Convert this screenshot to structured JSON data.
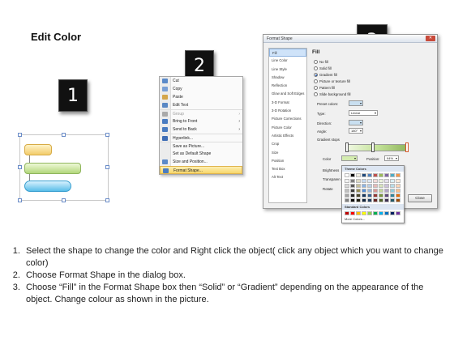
{
  "title": "Edit Color",
  "steps": [
    "1",
    "2",
    "3"
  ],
  "context_menu": {
    "items": [
      {
        "label": "Cut",
        "underline": "t",
        "icon": "scissors-icon",
        "color": "#5b8ac9"
      },
      {
        "label": "Copy",
        "icon": "copy-icon",
        "color": "#7aa0d6"
      },
      {
        "label": "Paste",
        "icon": "paste-icon",
        "color": "#d4a64b"
      },
      {
        "label": "Edit Text",
        "icon": "edit-text-icon",
        "color": "#5a88c4"
      },
      {
        "label": "Group",
        "icon": "group-icon",
        "color": "#aaaaaa",
        "disabled": true,
        "submenu": true
      },
      {
        "label": "Bring to Front",
        "icon": "bring-front-icon",
        "color": "#4a7cc1",
        "submenu": true
      },
      {
        "label": "Send to Back",
        "icon": "send-back-icon",
        "color": "#4a7cc1",
        "submenu": true
      },
      {
        "label": "Hyperlink...",
        "icon": "hyperlink-icon",
        "color": "#3e6db5"
      },
      {
        "label": "Save as Picture...",
        "icon": "",
        "color": ""
      },
      {
        "label": "Set as Default Shape",
        "icon": "",
        "color": ""
      },
      {
        "label": "Size and Position...",
        "icon": "size-icon",
        "color": "#5b8ac9"
      },
      {
        "label": "Format Shape...",
        "icon": "format-shape-icon",
        "color": "#4a7cc1",
        "highlighted": true
      }
    ]
  },
  "dialog": {
    "title": "Format Shape",
    "categories": [
      "Fill",
      "Line Color",
      "Line Style",
      "Shadow",
      "Reflection",
      "Glow and Soft Edges",
      "3-D Format",
      "3-D Rotation",
      "Picture Corrections",
      "Picture Color",
      "Artistic Effects",
      "Crop",
      "Size",
      "Position",
      "Text Box",
      "Alt Text"
    ],
    "selected_category": "Fill",
    "pane_heading": "Fill",
    "fill_options": [
      "No fill",
      "Solid fill",
      "Gradient fill",
      "Picture or texture fill",
      "Pattern fill",
      "Slide background fill"
    ],
    "selected_fill": "Gradient fill",
    "preset_colors_label": "Preset colors:",
    "type_label": "Type:",
    "type_value": "Linear",
    "direction_label": "Direction:",
    "angle_label": "Angle:",
    "angle_value": "180°",
    "gradient_stops_label": "Gradient stops",
    "color_label": "Color",
    "position_label": "Position:",
    "position_value": "94%",
    "brightness_label": "Brightness",
    "transparency_label": "Transparen",
    "rotate_label": "Rotate",
    "close_label": "Close",
    "palette": {
      "theme_header": "Theme Colors",
      "standard_header": "Standard Colors",
      "more_colors": "More Colors...",
      "theme_top": [
        "#ffffff",
        "#000000",
        "#eeece1",
        "#1f497d",
        "#4f81bd",
        "#c0504d",
        "#9bbb59",
        "#8064a2",
        "#4bacc6",
        "#f79646"
      ],
      "theme_shades": [
        [
          "#f2f2f2",
          "#7f7f7f",
          "#ddd9c3",
          "#c6d9f0",
          "#dbe5f1",
          "#f2dcdb",
          "#ebf1dd",
          "#e5e0ec",
          "#dbeef3",
          "#fdeada"
        ],
        [
          "#d8d8d8",
          "#595959",
          "#c4bd97",
          "#8db3e2",
          "#b8cce4",
          "#e5b9b7",
          "#d7e3bc",
          "#ccc1d9",
          "#b7dde8",
          "#fbd5b5"
        ],
        [
          "#bfbfbf",
          "#3f3f3f",
          "#938953",
          "#548dd4",
          "#95b3d7",
          "#d99694",
          "#c3d69b",
          "#b2a2c7",
          "#92cddc",
          "#fac08f"
        ],
        [
          "#a5a5a5",
          "#262626",
          "#494429",
          "#17365d",
          "#366092",
          "#953734",
          "#76923c",
          "#5f497a",
          "#31859b",
          "#e36c09"
        ],
        [
          "#7f7f7f",
          "#0c0c0c",
          "#1d1b10",
          "#0f243e",
          "#244061",
          "#632423",
          "#4f6128",
          "#3f3151",
          "#205867",
          "#974806"
        ]
      ],
      "standard": [
        "#c00000",
        "#ff0000",
        "#ffc000",
        "#ffff00",
        "#92d050",
        "#00b050",
        "#00b0f0",
        "#0070c0",
        "#002060",
        "#7030a0"
      ]
    }
  },
  "instructions": [
    "Select the shape to change the color and Right click the object( click any object which you want to change color)",
    "Choose Format Shape in the dialog box.",
    "Choose “Fill” in the Format Shape box then “Solid” or “Gradient” depending on the appearance of the object. Change colour as shown in the picture."
  ]
}
